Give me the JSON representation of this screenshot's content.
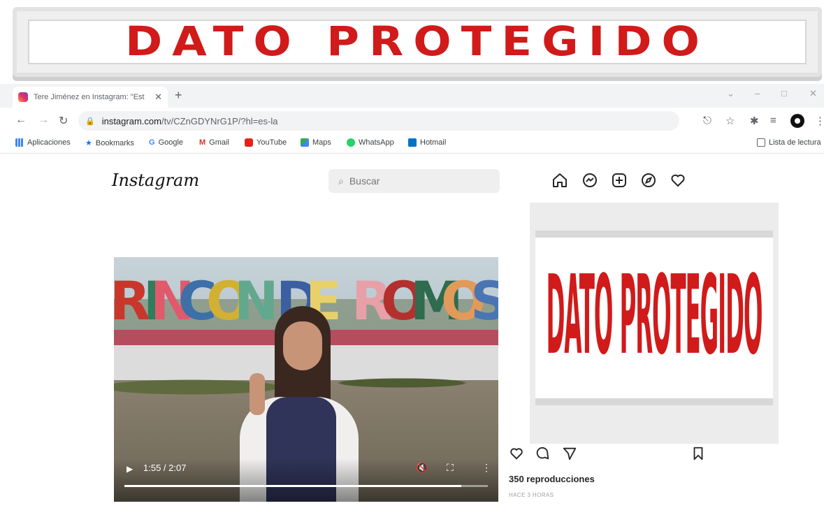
{
  "redaction": {
    "top_banner": "DATO PROTEGIDO",
    "side_panel": "DATO PROTEGIDO"
  },
  "browser": {
    "tab_title": "Tere Jiménez en Instagram: \"Est",
    "url_main": "instagram.com",
    "url_path": "/tv/CZnGDYNrG1P/?hl=es-la",
    "bookmarks": [
      "Aplicaciones",
      "Bookmarks",
      "Google",
      "Gmail",
      "YouTube",
      "Maps",
      "WhatsApp",
      "Hotmail"
    ],
    "reading_list": "Lista de lectura"
  },
  "instagram": {
    "logo": "Instagram",
    "search_placeholder": "Buscar",
    "nav_icons": [
      "home-icon",
      "messenger-icon",
      "new-post-icon",
      "explore-icon",
      "activity-heart-icon"
    ]
  },
  "video": {
    "sign_text": "RINCON DE ROMOS",
    "time": "1:55 / 2:07",
    "progress": 0.926
  },
  "post": {
    "views": "350 reproducciones",
    "time_ago": "HACE 3 HORAS"
  }
}
